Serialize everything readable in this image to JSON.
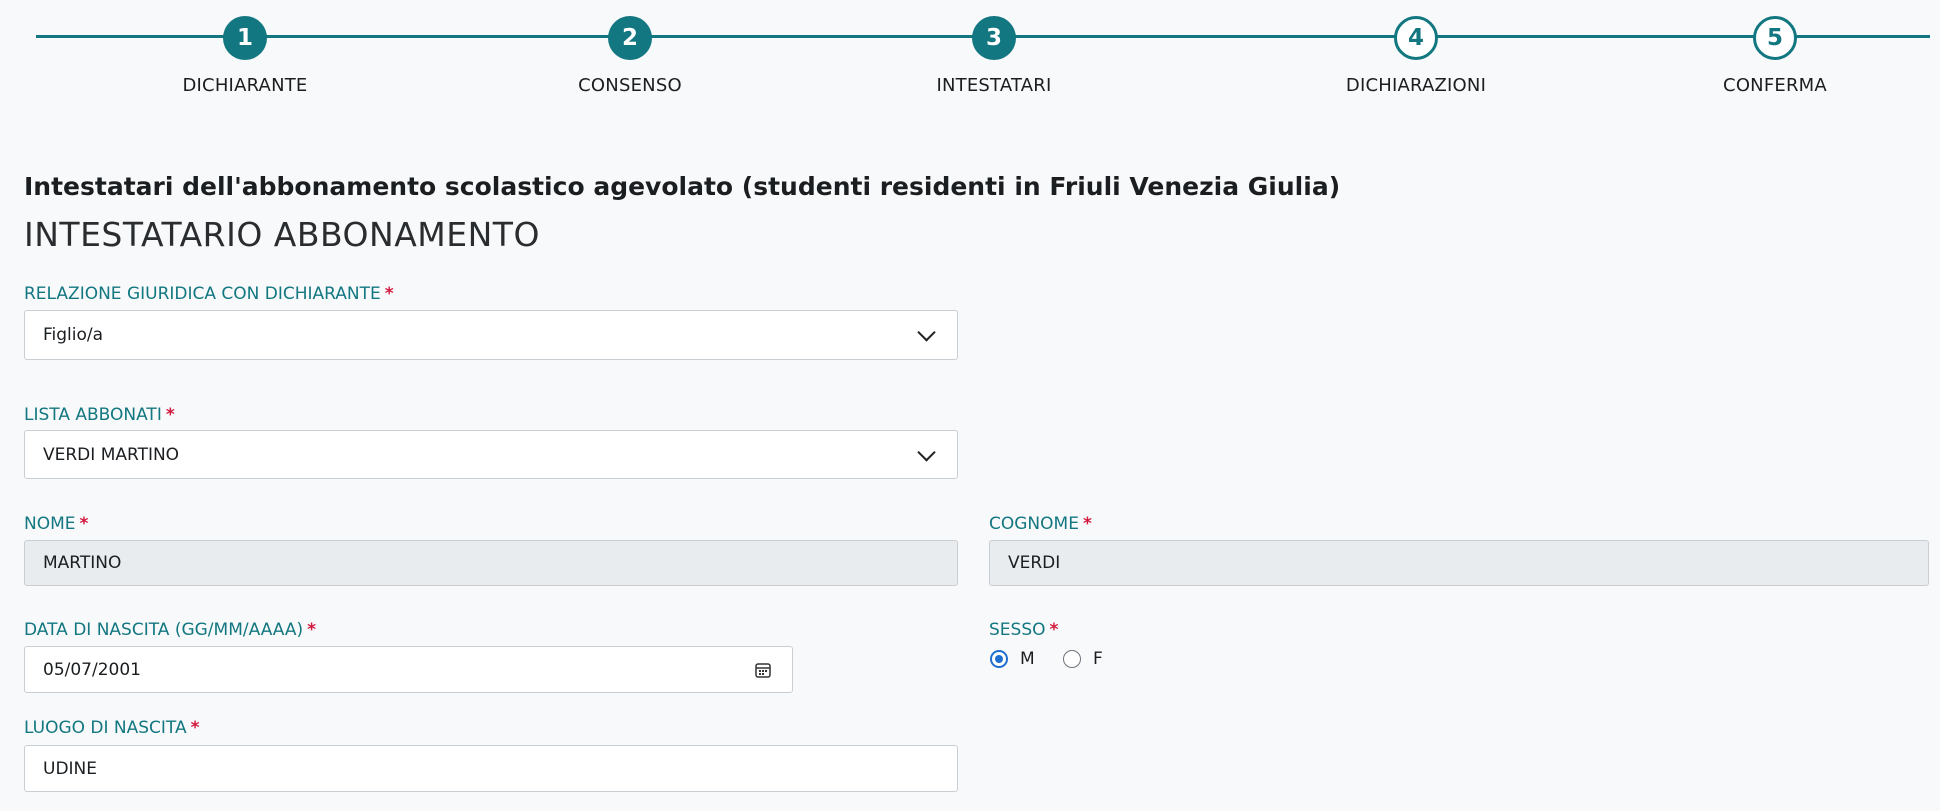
{
  "stepper": {
    "steps": [
      {
        "number": "1",
        "label": "DICHIARANTE",
        "state": "done"
      },
      {
        "number": "2",
        "label": "CONSENSO",
        "state": "done"
      },
      {
        "number": "3",
        "label": "INTESTATARI",
        "state": "current"
      },
      {
        "number": "4",
        "label": "DICHIARAZIONI",
        "state": "todo"
      },
      {
        "number": "5",
        "label": "CONFERMA",
        "state": "todo"
      }
    ]
  },
  "section_title": "Intestatari dell'abbonamento scolastico agevolato (studenti residenti in Friuli Venezia Giulia)",
  "subsection_title": "INTESTATARIO ABBONAMENTO",
  "required_marker": "*",
  "form": {
    "relazione": {
      "label": "RELAZIONE GIURIDICA CON DICHIARANTE",
      "value": "Figlio/a"
    },
    "lista_abbonati": {
      "label": "LISTA ABBONATI",
      "value": "VERDI MARTINO"
    },
    "nome": {
      "label": "NOME",
      "value": "MARTINO"
    },
    "cognome": {
      "label": "COGNOME",
      "value": "VERDI"
    },
    "data_nascita": {
      "label": "DATA DI NASCITA (GG/MM/AAAA)",
      "value": "05/07/2001"
    },
    "sesso": {
      "label": "SESSO",
      "options": [
        "M",
        "F"
      ],
      "selected": "M"
    },
    "luogo_nascita": {
      "label": "LUOGO DI NASCITA",
      "value": "UDINE"
    }
  },
  "colors": {
    "accent": "#127780",
    "required": "#d2193e",
    "radio_selected": "#1f6fd1",
    "readonly_bg": "#e9ecef"
  },
  "icons": [
    "chevron-down-icon",
    "calendar-icon"
  ]
}
